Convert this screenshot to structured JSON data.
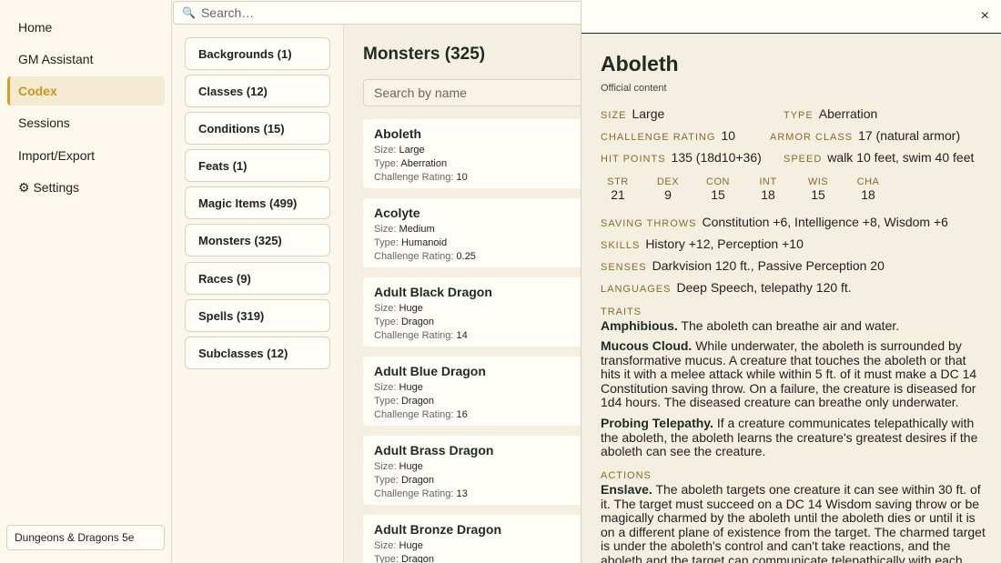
{
  "nav": {
    "items": [
      {
        "label": "Home"
      },
      {
        "label": "GM Assistant"
      },
      {
        "label": "Codex"
      },
      {
        "label": "Sessions"
      },
      {
        "label": "Import/Export"
      },
      {
        "label": "⚙ Settings"
      }
    ],
    "system": "Dungeons & Dragons 5e"
  },
  "search": {
    "placeholder": "Search…"
  },
  "categories": [
    "Backgrounds (1)",
    "Classes (12)",
    "Conditions (15)",
    "Feats (1)",
    "Magic Items (499)",
    "Monsters (325)",
    "Races (9)",
    "Spells (319)",
    "Subclasses (12)"
  ],
  "list": {
    "title": "Monsters (325)",
    "search_placeholder": "Search by name",
    "size_label": "Size:",
    "type_label": "Type:",
    "cr_label": "Challenge Rating:",
    "monsters": [
      {
        "name": "Aboleth",
        "size": "Large",
        "type": "Aberration",
        "cr": "10"
      },
      {
        "name": "Acolyte",
        "size": "Medium",
        "type": "Humanoid",
        "cr": "0.25"
      },
      {
        "name": "Adult Black Dragon",
        "size": "Huge",
        "type": "Dragon",
        "cr": "14"
      },
      {
        "name": "Adult Blue Dragon",
        "size": "Huge",
        "type": "Dragon",
        "cr": "16"
      },
      {
        "name": "Adult Brass Dragon",
        "size": "Huge",
        "type": "Dragon",
        "cr": "13"
      },
      {
        "name": "Adult Bronze Dragon",
        "size": "Huge",
        "type": "Dragon",
        "cr": ""
      }
    ]
  },
  "detail": {
    "close": "×",
    "name": "Aboleth",
    "source": "Official content",
    "size_label": "Size",
    "size": "Large",
    "type_label": "Type",
    "type": "Aberration",
    "cr_label": "Challenge Rating",
    "cr": "10",
    "ac_label": "Armor Class",
    "ac": "17 (natural armor)",
    "hp_label": "Hit Points",
    "hp": "135 (18d10+36)",
    "speed_label": "Speed",
    "speed": "walk 10 feet, swim 40 feet",
    "abilities": [
      {
        "k": "STR",
        "v": "21"
      },
      {
        "k": "DEX",
        "v": "9"
      },
      {
        "k": "CON",
        "v": "15"
      },
      {
        "k": "INT",
        "v": "18"
      },
      {
        "k": "WIS",
        "v": "15"
      },
      {
        "k": "CHA",
        "v": "18"
      }
    ],
    "saves_label": "Saving Throws",
    "saves": "Constitution +6, Intelligence +8, Wisdom +6",
    "skills_label": "Skills",
    "skills": "History +12, Perception +10",
    "senses_label": "Senses",
    "senses": "Darkvision 120 ft., Passive Perception 20",
    "languages_label": "Languages",
    "languages": "Deep Speech, telepathy 120 ft.",
    "traits_label": "Traits",
    "traits": [
      {
        "name": "Amphibious.",
        "text": "The aboleth can breathe air and water."
      },
      {
        "name": "Mucous Cloud.",
        "text": "While underwater, the aboleth is surrounded by transformative mucus. A creature that touches the aboleth or that hits it with a melee attack while within 5 ft. of it must make a DC 14 Constitution saving throw. On a failure, the creature is diseased for 1d4 hours. The diseased creature can breathe only underwater."
      },
      {
        "name": "Probing Telepathy.",
        "text": "If a creature communicates telepathically with the aboleth, the aboleth learns the creature's greatest desires if the aboleth can see the creature."
      }
    ],
    "actions_label": "Actions",
    "actions": [
      {
        "name": "Enslave.",
        "text": "The aboleth targets one creature it can see within 30 ft. of it. The target must succeed on a DC 14 Wisdom saving throw or be magically charmed by the aboleth until the aboleth dies or until it is on a different plane of existence from the target. The charmed target is under the aboleth's control and can't take reactions, and the aboleth and the target can communicate telepathically with each"
      }
    ]
  }
}
